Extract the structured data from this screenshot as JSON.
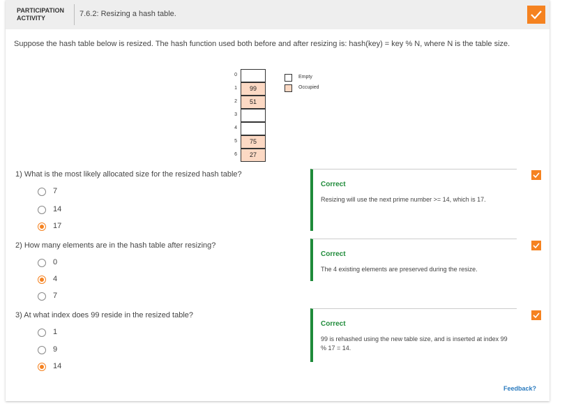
{
  "activity": {
    "label_line1": "PARTICIPATION",
    "label_line2": "ACTIVITY",
    "title": "7.6.2: Resizing a hash table.",
    "completion_color": "#f58220"
  },
  "intro": "Suppose the hash table below is resized. The hash function used both before and after resizing is: hash(key) = key % N, where N is the table size.",
  "hash_table": {
    "rows": [
      {
        "index": "0",
        "value": "",
        "occupied": false
      },
      {
        "index": "1",
        "value": "99",
        "occupied": true
      },
      {
        "index": "2",
        "value": "51",
        "occupied": true
      },
      {
        "index": "3",
        "value": "",
        "occupied": false
      },
      {
        "index": "4",
        "value": "",
        "occupied": false
      },
      {
        "index": "5",
        "value": "75",
        "occupied": true
      },
      {
        "index": "6",
        "value": "27",
        "occupied": true
      }
    ],
    "legend": {
      "empty": "Empty",
      "occupied": "Occupied"
    },
    "occupied_color": "#fcd9c4"
  },
  "questions": [
    {
      "text": "1) What is the most likely allocated size for the resized hash table?",
      "options": [
        {
          "label": "7",
          "selected": false
        },
        {
          "label": "14",
          "selected": false
        },
        {
          "label": "17",
          "selected": true
        }
      ],
      "feedback": {
        "status": "Correct",
        "explanation": "Resizing will use the next prime number >= 14, which is 17."
      }
    },
    {
      "text": "2) How many elements are in the hash table after resizing?",
      "options": [
        {
          "label": "0",
          "selected": false
        },
        {
          "label": "4",
          "selected": true
        },
        {
          "label": "7",
          "selected": false
        }
      ],
      "feedback": {
        "status": "Correct",
        "explanation": "The 4 existing elements are preserved during the resize."
      }
    },
    {
      "text": "3) At what index does 99 reside in the resized table?",
      "options": [
        {
          "label": "1",
          "selected": false
        },
        {
          "label": "9",
          "selected": false
        },
        {
          "label": "14",
          "selected": true
        }
      ],
      "feedback": {
        "status": "Correct",
        "explanation": "99 is rehashed using the new table size, and is inserted at index 99 % 17 = 14."
      }
    }
  ],
  "feedback_link": "Feedback?",
  "colors": {
    "accent": "#f58220",
    "correct": "#1f8b3a",
    "link": "#2b7bbf"
  }
}
